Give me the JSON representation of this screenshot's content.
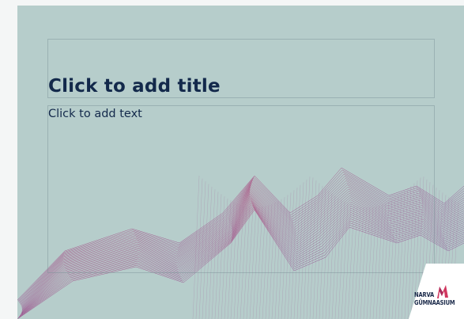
{
  "slide": {
    "title_placeholder": "Click to add title",
    "body_placeholder": "Click to add text"
  },
  "logo": {
    "line1": "NARVA",
    "line2": "GÜMNAASIUM"
  },
  "colors": {
    "slide_background": "#b6cdcb",
    "title_color": "#13294b",
    "line_gradient_start": "#c2476f",
    "line_gradient_end": "#6c3f9e",
    "logo_accent": "#d1365e"
  },
  "icons": {
    "logo_mark": "narva-gymnasium-logo-icon",
    "wave_art": "decorative-line-wave-art"
  }
}
